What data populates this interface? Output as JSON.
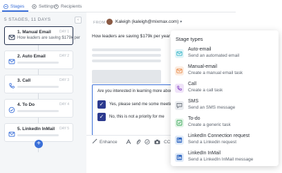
{
  "tabs": [
    {
      "label": "Stages",
      "icon": "stages-icon",
      "active": true
    },
    {
      "label": "Settings",
      "icon": "gear-icon",
      "active": false
    },
    {
      "label": "Recipients",
      "icon": "recipients-icon",
      "active": false
    }
  ],
  "sidebar": {
    "header": "5 STAGES, 11 DAYS",
    "stages": [
      {
        "title": "1. Manual Email",
        "subtitle": "How leaders are saving $179k per ...",
        "day": "DAY 1",
        "icon": "email-icon",
        "selected": true
      },
      {
        "title": "2. Auto Email",
        "subtitle": "",
        "day": "DAY 2",
        "icon": "email-icon",
        "selected": false
      },
      {
        "title": "3. Call",
        "subtitle": "",
        "day": "DAY 3",
        "icon": "phone-icon",
        "selected": false
      },
      {
        "title": "4. To Do",
        "subtitle": "",
        "day": "DAY 4",
        "icon": "todo-icon",
        "selected": false
      },
      {
        "title": "5. LinkedIn InMail",
        "subtitle": "",
        "day": "DAY 5",
        "icon": "linkedin-icon",
        "selected": false
      }
    ],
    "add_button": "+"
  },
  "email": {
    "from_label": "FROM",
    "from_name": "Kaleigh (kaleigh@mixmax.com)",
    "subject": "How leaders are saving $179k per year",
    "question": "Are you interested in learning more about how",
    "options": [
      "Yes, please send me some meeting t",
      "No, this is not a priority for me"
    ],
    "toolbar": {
      "enhance": "Enhance",
      "cc": "CC"
    }
  },
  "stage_types": {
    "title": "Stage types",
    "items": [
      {
        "name": "Auto-email",
        "desc": "Send an automated email",
        "icon": "email-icon",
        "color": "#39b6c9",
        "bg": "#e2f5f8"
      },
      {
        "name": "Manual-email",
        "desc": "Create a manual email task",
        "icon": "email-icon",
        "color": "#e98a47",
        "bg": "#fcece0"
      },
      {
        "name": "Call",
        "desc": "Create a call task",
        "icon": "phone-icon",
        "color": "#8f4fc9",
        "bg": "#efe3f8"
      },
      {
        "name": "SMS",
        "desc": "Send an SMS message",
        "icon": "sms-icon",
        "color": "#6c737d",
        "bg": "#ebedf0"
      },
      {
        "name": "To-do",
        "desc": "Create a generic task",
        "icon": "todo-icon",
        "color": "#3aa857",
        "bg": "#e3f4e8"
      },
      {
        "name": "LinkedIn Connection request",
        "desc": "Send a Linkedin request",
        "icon": "linkedin-icon",
        "color": "#2f67c2",
        "bg": "#e1ebf8"
      },
      {
        "name": "LinkedIn InMail",
        "desc": "Send a LinkedIn InMail message",
        "icon": "linkedin-icon",
        "color": "#2f67c2",
        "bg": "#e1ebf8"
      }
    ]
  }
}
